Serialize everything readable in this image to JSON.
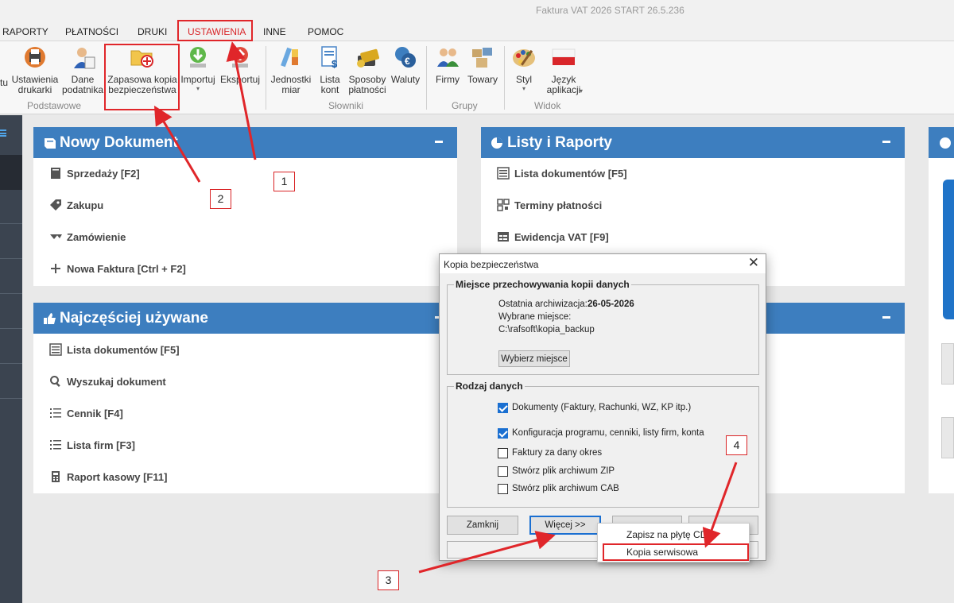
{
  "app": {
    "title": "Faktura VAT 2026 START 26.5.236"
  },
  "menu": {
    "items": [
      "RAPORTY",
      "PŁATNOŚCI",
      "DRUKI",
      "USTAWIENIA",
      "INNE",
      "POMOC"
    ]
  },
  "ribbon": {
    "cut_label": "tu",
    "buttons": {
      "ustawienia_drukarki": "Ustawienia\ndrukarki",
      "dane_podatnika": "Dane\npodatnika",
      "zapasowa_kopia": "Zapasowa kopia\nbezpieczeństwa",
      "importuj": "Importuj",
      "eksportuj": "Eksportuj",
      "jednostki_miar": "Jednostki\nmiar",
      "lista_kont": "Lista\nkont",
      "sposoby_platnosci": "Sposoby\npłatności",
      "waluty": "Waluty",
      "firmy": "Firmy",
      "towary": "Towary",
      "styl": "Styl",
      "jezyk_aplikacji": "Język\naplikacji"
    },
    "dropdown_glyph": "▾",
    "groups": {
      "podstawowe": "Podstawowe",
      "slowniki": "Słowniki",
      "grupy": "Grupy",
      "widok": "Widok"
    }
  },
  "panels": {
    "nowy_dokument": {
      "title": "Nowy Dokument",
      "links": [
        "Sprzedaży [F2]",
        "Zakupu",
        "Zamówienie",
        "Nowa Faktura [Ctrl + F2]"
      ]
    },
    "listy_raporty": {
      "title": "Listy i Raporty",
      "links": [
        "Lista dokumentów [F5]",
        "Terminy płatności",
        "Ewidencja VAT [F9]"
      ]
    },
    "najczesciej": {
      "title": "Najczęściej używane",
      "links": [
        "Lista dokumentów [F5]",
        "Wyszukaj dokument",
        "Cennik [F4]",
        "Lista firm [F3]",
        "Raport kasowy [F11]"
      ]
    }
  },
  "dialog": {
    "title": "Kopia bezpieczeństwa",
    "group_storage": {
      "title": "Miejsce przechowywania kopii danych",
      "last_archive_label": "Ostatnia archiwizacja:",
      "last_archive_value": "26-05-2026",
      "chosen_place_label": "Wybrane miejsce:",
      "path": "C:\\rafsoft\\kopia_backup",
      "choose_button": "Wybierz miejsce"
    },
    "group_data": {
      "title": "Rodzaj danych",
      "options": [
        {
          "label": "Dokumenty (Faktury, Rachunki, WZ, KP itp.)",
          "checked": true
        },
        {
          "label": "Konfiguracja programu, cenniki, listy firm, konta",
          "checked": true
        },
        {
          "label": "Faktury za dany okres",
          "checked": false
        },
        {
          "label": "Stwórz plik archiwum ZIP",
          "checked": false
        },
        {
          "label": "Stwórz plik archiwum CAB",
          "checked": false
        }
      ]
    },
    "buttons": {
      "zamknij": "Zamknij",
      "wiecej": "Więcej >>"
    }
  },
  "popup": {
    "items": [
      "Zapisz na płytę CD",
      "Kopia serwisowa"
    ]
  },
  "annotations": {
    "labels": [
      "1",
      "2",
      "3",
      "4"
    ],
    "color": "#e0262a"
  },
  "colors": {
    "panel_header": "#3d7ebf",
    "menu_active": "#d9262a",
    "sidebar": "#3b4450"
  }
}
